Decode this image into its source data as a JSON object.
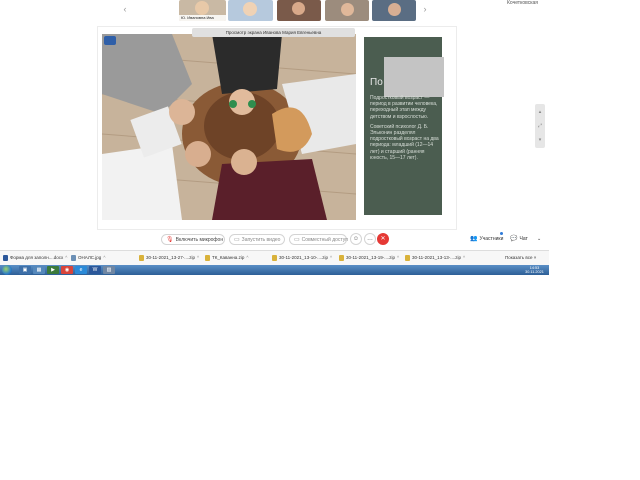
{
  "participants": {
    "prev_label": "‹",
    "next_label": "›",
    "tiles": [
      {
        "name": "Ю. Ивановна Ива",
        "bg": "#c9b9a4",
        "face": "#e8c9a8"
      },
      {
        "name": "",
        "bg": "#b6c9dd",
        "face": "#efd2b5"
      },
      {
        "name": "",
        "bg": "#7a5a4a",
        "face": "#d9a98a"
      },
      {
        "name": "",
        "bg": "#9c8c7d",
        "face": "#e0b89a"
      },
      {
        "name": "",
        "bg": "#5a6d83",
        "face": "#d7ae93"
      }
    ]
  },
  "top_right_label": "Кочетковская",
  "share": {
    "viewing_text": "Просмотр экрана Иванова Мария Евгеньевна"
  },
  "slide": {
    "title": "По",
    "paragraph1": "Подростковый возраст — период в развитии человека, переходный этап между детством и взрослостью.",
    "paragraph2": "Советский психолог Д. Б. Эльконин разделял подростковый возраст на два периода: младший (12—14 лет) и старший (ранняя юность, 15—17 лет)."
  },
  "controls": {
    "mic_label": "Включить микрофон",
    "video_label": "Запустить видео",
    "share_label": "Совместный доступ",
    "participants_label": "Участники",
    "chat_label": "Чат",
    "more_label": "⌄"
  },
  "downloads": {
    "items": [
      {
        "label": "Форма для заполн....docx",
        "icon_color": "#2b579a"
      },
      {
        "label": "ОНАЛС.jpg",
        "icon_color": "#6b8fb5"
      },
      {
        "label": "30-11-2021_13-27-....zip",
        "icon_color": "#d9b23a"
      },
      {
        "label": "ТК_Каванна.zip",
        "icon_color": "#d9b23a"
      },
      {
        "label": "30-11-2021_13-10-....zip",
        "icon_color": "#d9b23a"
      },
      {
        "label": "30-11-2021_13-19-....zip",
        "icon_color": "#d9b23a"
      },
      {
        "label": "30-11-2021_13-13-....zip",
        "icon_color": "#d9b23a"
      }
    ],
    "show_all": "Показать все",
    "close": "×"
  },
  "taskbar": {
    "time": "14:53",
    "date": "30.11.2021",
    "apps": [
      {
        "glyph": "▣",
        "color": "#3d6fa8"
      },
      {
        "glyph": "▦",
        "color": "#5588bb"
      },
      {
        "glyph": "▶",
        "color": "#3b7a3b"
      },
      {
        "glyph": "◉",
        "color": "#d9443a"
      },
      {
        "glyph": "e",
        "color": "#2b8ad8"
      },
      {
        "glyph": "W",
        "color": "#2b579a"
      },
      {
        "glyph": "▨",
        "color": "#6f86a3"
      }
    ]
  }
}
